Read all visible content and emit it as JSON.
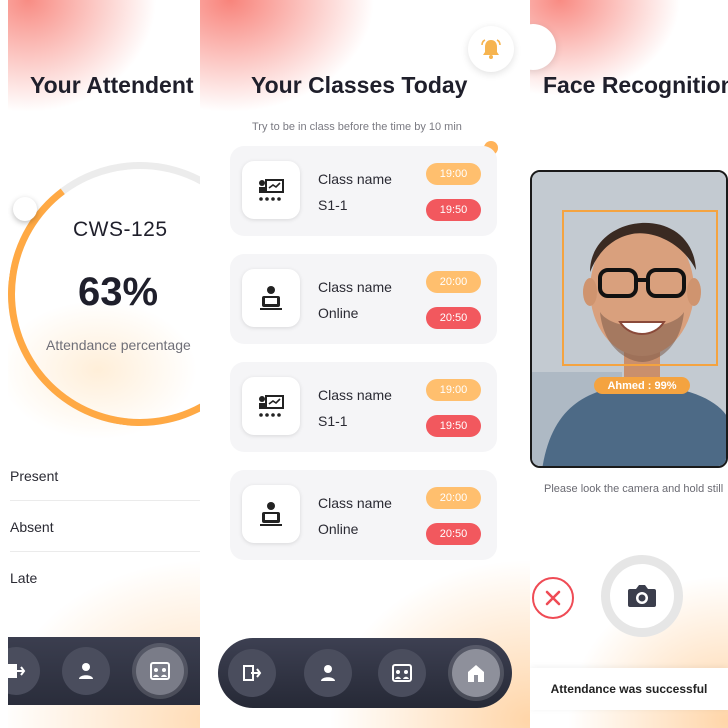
{
  "attendance": {
    "title": "Your Attendent",
    "course_code": "CWS-125",
    "percentage": "63%",
    "percentage_caption": "Attendance percentage",
    "stats": [
      "Present",
      "Absent",
      "Late"
    ],
    "nav": [
      "logout-icon",
      "person-icon",
      "classes-icon"
    ]
  },
  "classes": {
    "title": "Your Classes Today",
    "subtitle": "Try to be in class before the time by 10 min",
    "cards": [
      {
        "name": "Class name",
        "room": "S1-1",
        "start": "19:00",
        "end": "19:50",
        "icon": "classroom-icon"
      },
      {
        "name": "Class name",
        "room": "Online",
        "start": "20:00",
        "end": "20:50",
        "icon": "online-icon"
      },
      {
        "name": "Class name",
        "room": "S1-1",
        "start": "19:00",
        "end": "19:50",
        "icon": "classroom-icon"
      },
      {
        "name": "Class name",
        "room": "Online",
        "start": "20:00",
        "end": "20:50",
        "icon": "online-icon"
      }
    ],
    "nav": [
      "logout-icon",
      "person-icon",
      "classes-icon",
      "home-icon"
    ]
  },
  "face": {
    "title": "Face Recognition",
    "match_label": "Ahmed : 99%",
    "hint": "Please look the camera and hold still",
    "toast": "Attendance was successful"
  },
  "colors": {
    "accent_orange": "#ffbf6e",
    "accent_red": "#f2585e",
    "nav_dark": "#2a2d3b"
  }
}
